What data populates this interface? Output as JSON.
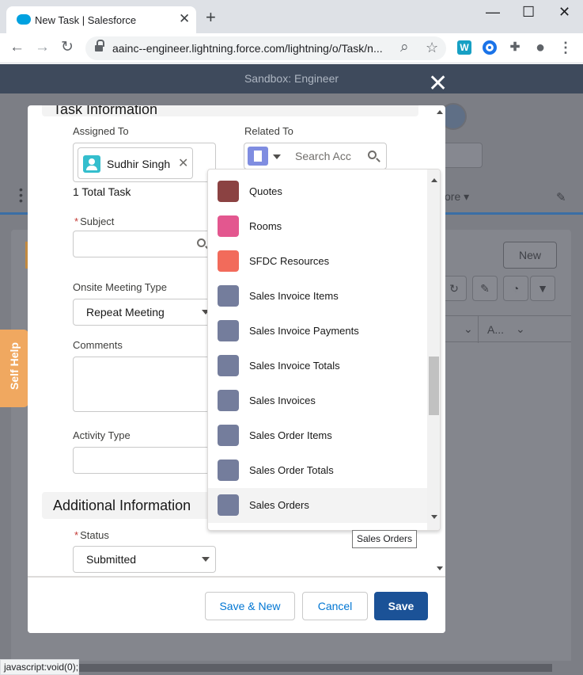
{
  "browser": {
    "tab_title": "New Task | Salesforce",
    "tab_close": "✕",
    "new_tab": "+",
    "window_controls": {
      "minimize": "—",
      "maximize": "☐",
      "close": "✕"
    },
    "nav": {
      "back": "←",
      "forward": "→",
      "reload": "↻"
    },
    "url": "aainc--engineer.lightning.force.com/lightning/o/Task/n...",
    "zoom_icon": "⌕",
    "star_icon": "☆",
    "extensions": {
      "w_label": "W",
      "puzzle": "✚",
      "account": "●",
      "menu": "⋮"
    },
    "status_text": "javascript:void(0);"
  },
  "salesforce": {
    "sandbox_label": "Sandbox: Engineer",
    "modal_close": "✕",
    "background": {
      "more_label": "ore",
      "new_button": "New",
      "col_a_label": "A..."
    }
  },
  "self_help": {
    "label": "Self Help"
  },
  "form": {
    "section_task_title": "Task Information",
    "assigned_to": {
      "label": "Assigned To",
      "value": "Sudhir Singh",
      "clear_icon": "✕",
      "total": "1 Total Task"
    },
    "related_to": {
      "label": "Related To",
      "placeholder": "Search Acc"
    },
    "subject": {
      "required": "*",
      "label": "Subject"
    },
    "onsite_meeting_type": {
      "label": "Onsite Meeting Type",
      "value": "Repeat Meeting"
    },
    "comments": {
      "label": "Comments"
    },
    "activity_type": {
      "label": "Activity Type"
    },
    "section_additional_title": "Additional Information",
    "status": {
      "required": "*",
      "label": "Status",
      "value": "Submitted"
    }
  },
  "footer": {
    "save_new": "Save & New",
    "cancel": "Cancel",
    "save": "Save"
  },
  "dropdown": {
    "items": [
      {
        "label": "Quotes",
        "icon": "cart-icon",
        "color": "#8b4242"
      },
      {
        "label": "Rooms",
        "icon": "building-icon",
        "color": "#e3578f"
      },
      {
        "label": "SFDC Resources",
        "icon": "people-icon",
        "color": "#f26b5b"
      },
      {
        "label": "Sales Invoice Items",
        "icon": "custom-object-icon",
        "color": "#747d9c"
      },
      {
        "label": "Sales Invoice Payments",
        "icon": "custom-object-icon",
        "color": "#747d9c"
      },
      {
        "label": "Sales Invoice Totals",
        "icon": "custom-object-icon",
        "color": "#747d9c"
      },
      {
        "label": "Sales Invoices",
        "icon": "custom-object-icon",
        "color": "#747d9c"
      },
      {
        "label": "Sales Order Items",
        "icon": "custom-object-icon",
        "color": "#747d9c"
      },
      {
        "label": "Sales Order Totals",
        "icon": "custom-object-icon",
        "color": "#747d9c"
      },
      {
        "label": "Sales Orders",
        "icon": "custom-object-icon",
        "color": "#747d9c"
      }
    ],
    "tooltip": "Sales Orders"
  },
  "colors": {
    "brand": "#1b5297",
    "link": "#0176d3",
    "sandbox_bar": "#3e4a5c"
  }
}
